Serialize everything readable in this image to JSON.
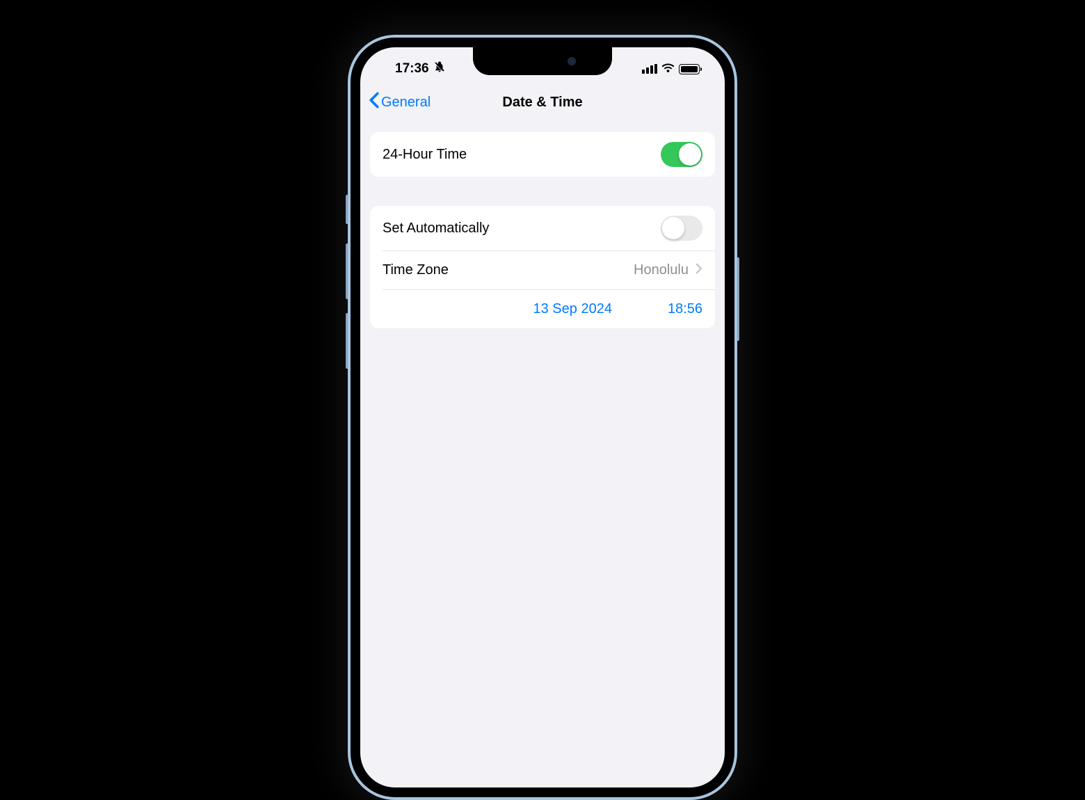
{
  "status_bar": {
    "time": "17:36"
  },
  "nav": {
    "back_label": "General",
    "title": "Date & Time"
  },
  "group1": {
    "row_24hour": {
      "label": "24-Hour Time",
      "toggle_on": true
    }
  },
  "group2": {
    "row_auto": {
      "label": "Set Automatically",
      "toggle_on": false
    },
    "row_timezone": {
      "label": "Time Zone",
      "value": "Honolulu"
    },
    "row_datetime": {
      "date": "13 Sep 2024",
      "time": "18:56"
    }
  }
}
